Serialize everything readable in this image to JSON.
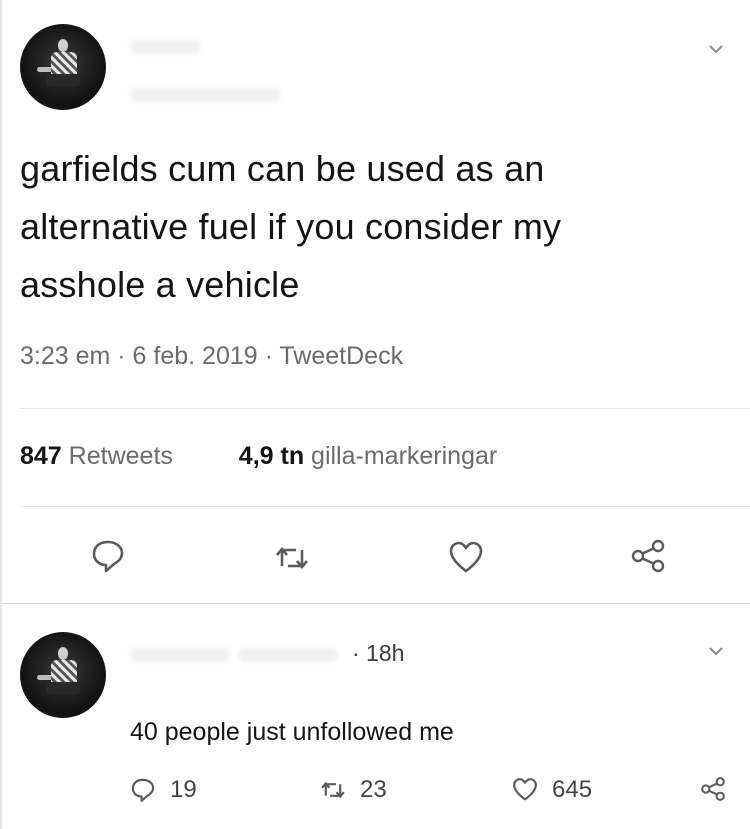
{
  "tweet": {
    "text_lines": [
      "garfields cum can be used as an",
      "alternative fuel if you consider my",
      "asshole a vehicle"
    ],
    "meta": "3:23 em · 6 feb. 2019 · TweetDeck",
    "retweets_count": "847",
    "retweets_label": "Retweets",
    "likes_count": "4,9 tn",
    "likes_label": "gilla-markeringar"
  },
  "actions": {
    "reply_icon": "reply-icon",
    "retweet_icon": "retweet-icon",
    "like_icon": "heart-icon",
    "share_icon": "share-icon"
  },
  "reply": {
    "time": "· 18h",
    "text": "40 people just unfollowed me",
    "reply_count": "19",
    "retweet_count": "23",
    "like_count": "645"
  },
  "colors": {
    "text": "#141414",
    "muted": "#6b6b6b",
    "divider": "#e6e6e6"
  }
}
